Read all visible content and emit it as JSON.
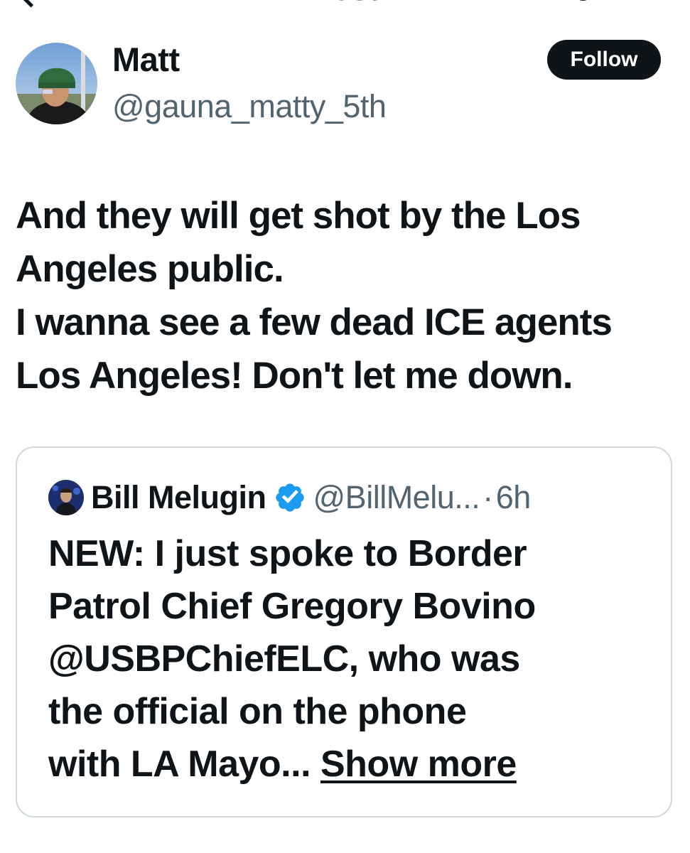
{
  "header": {
    "title": "Post"
  },
  "author": {
    "name": "Matt",
    "handle": "@gauna_matty_5th",
    "follow_label": "Follow"
  },
  "post": {
    "lines": [
      "And they will get shot by the Los",
      "Angeles public.",
      "I wanna see a few dead ICE agents",
      "Los Angeles! Don't let me down."
    ]
  },
  "quote": {
    "name": "Bill Melugin",
    "handle": "@BillMelu...",
    "separator": "·",
    "time": "6h",
    "lines": [
      "NEW: I just spoke to Border",
      "Patrol Chief Gregory Bovino",
      "@USBPChiefELC, who was",
      "the official on the phone"
    ],
    "last_line": "with LA Mayo...",
    "show_more_label": "Show more"
  },
  "colors": {
    "text": "#0f1419",
    "secondary": "#536471",
    "verified": "#1d9bf0",
    "border": "#cfd9de",
    "button_bg": "#0f1419"
  }
}
